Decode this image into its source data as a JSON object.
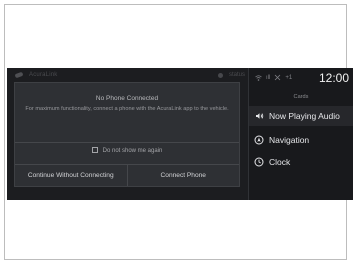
{
  "background_status": {
    "app_name": "AcuraLink",
    "right_text": "status"
  },
  "dialog": {
    "title": "No Phone Connected",
    "message": "For maximum functionality, connect a phone with the AcuraLink app to the vehicle.",
    "checkbox_label": "Do not show me again",
    "checkbox_checked": false,
    "continue_button": "Continue Without Connecting",
    "connect_button": "Connect Phone"
  },
  "status_bar": {
    "signal_text": "ıll",
    "badge_text": "+1",
    "time": "12:00"
  },
  "cards": {
    "label": "Cards",
    "items": [
      {
        "label": "Now Playing Audio",
        "icon": "speaker-icon"
      },
      {
        "label": "Navigation",
        "icon": "navigation-icon"
      },
      {
        "label": "Clock",
        "icon": "clock-icon"
      }
    ]
  },
  "colors": {
    "screen_bg": "#1c1d20",
    "dialog_bg": "#2e3034",
    "text_primary": "#e6e7ea"
  }
}
